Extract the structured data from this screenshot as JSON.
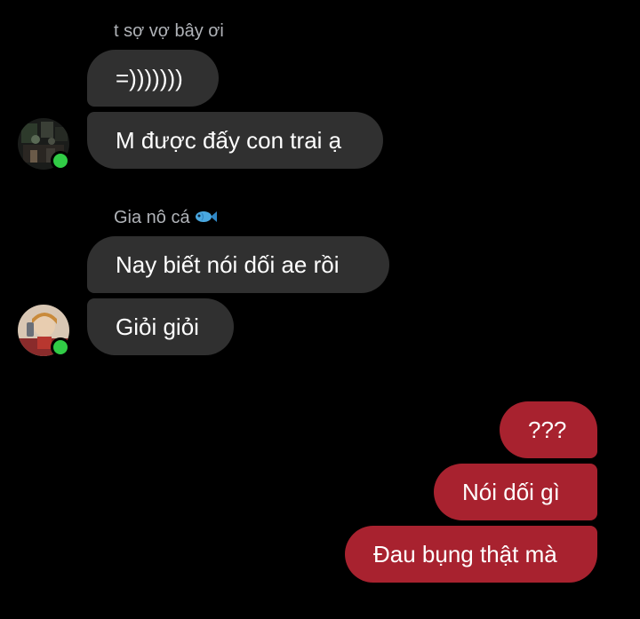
{
  "colors": {
    "background": "#000000",
    "incoming_bubble": "#303030",
    "outgoing_bubble": "#a8222f",
    "sender_name": "#b0b3b8",
    "online": "#31cc46"
  },
  "threads": [
    {
      "sender": "t sợ vợ bây ơi",
      "avatar_icon": "user-avatar-dark-photo",
      "online": true,
      "messages": [
        "=)))))))",
        "M được đấy con trai ạ"
      ]
    },
    {
      "sender": "Gia nô cá",
      "sender_emoji": "fish-icon",
      "avatar_icon": "user-avatar-selfie-photo",
      "online": true,
      "messages": [
        "Nay biết nói dối ae rồi",
        "Giỏi giỏi"
      ]
    }
  ],
  "outgoing": [
    "???",
    "Nói dối gì",
    "Đau bụng thật mà"
  ]
}
